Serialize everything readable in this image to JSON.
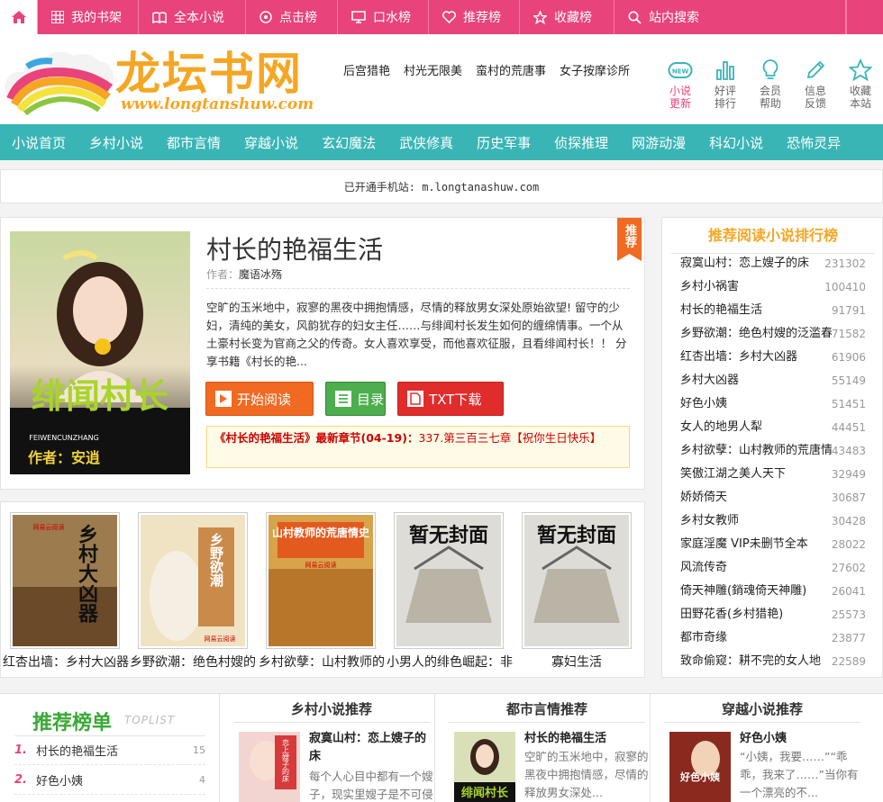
{
  "topnav": {
    "items": [
      {
        "label": "我的书架",
        "icon": "grid-icon"
      },
      {
        "label": "全本小说",
        "icon": "book-icon"
      },
      {
        "label": "点击榜",
        "icon": "target-icon"
      },
      {
        "label": "口水榜",
        "icon": "monitor-icon"
      },
      {
        "label": "推荐榜",
        "icon": "heart-icon"
      },
      {
        "label": "收藏榜",
        "icon": "star-icon"
      },
      {
        "label": "站内搜索",
        "icon": "search-icon"
      }
    ]
  },
  "header": {
    "logo_text": "龙坛书网",
    "logo_url": "www.longtanshuw.com",
    "hot_links": [
      "后宫猎艳",
      "村光无限美",
      "蛮村的荒唐事",
      "女子按摩诊所"
    ],
    "quick": [
      {
        "l1": "小说",
        "l2": "更新",
        "icon": "new-icon"
      },
      {
        "l1": "好评",
        "l2": "排行",
        "icon": "bar-chart-icon"
      },
      {
        "l1": "会员",
        "l2": "帮助",
        "icon": "lightbulb-icon"
      },
      {
        "l1": "信息",
        "l2": "反馈",
        "icon": "pencil-icon"
      },
      {
        "l1": "收藏",
        "l2": "本站",
        "icon": "star-outline-icon"
      }
    ]
  },
  "nav": [
    "小说首页",
    "乡村小说",
    "都市言情",
    "穿越小说",
    "玄幻魔法",
    "武侠修真",
    "历史军事",
    "侦探推理",
    "网游动漫",
    "科幻小说",
    "恐怖灵异"
  ],
  "mobile_notice": "已开通手机站: m.longtanashuw.com",
  "featured": {
    "badge": "推荐",
    "title": "村长的艳福生活",
    "author_label": "作者：",
    "author": "魔语冰殇",
    "description": "空旷的玉米地中，寂寥的黑夜中拥抱情感，尽情的释放男女深处原始欲望! 留守的少妇，清纯的美女，风韵犹存的妇女主任……与绯闻村长发生如何的缠绵情事。一个从土豪村长变为官商之父的传奇。女人喜欢享受，而他喜欢征服，且看绯闻村长！！  分享书籍《村长的艳...",
    "btn_read": "开始阅读",
    "btn_dir": "目录",
    "btn_txt": "TXT下载",
    "latest_name": "《村长的艳福生活》最新章节(04-19)：",
    "latest_chapter": "337.第三百三七章【祝你生日快乐】",
    "cover_title": "绯闻村长",
    "cover_pinyin": "FEIWENCUNZHANG",
    "cover_author": "作者：安逍"
  },
  "strip": {
    "books": [
      {
        "cover_text": "乡村大凶器",
        "publisher": "网易云阅读"
      },
      {
        "cover_text": "乡野欲潮",
        "publisher": "网易云阅读"
      },
      {
        "cover_text": "山村教师的荒唐情史",
        "publisher": "网易云阅读"
      },
      {
        "cover_text": "暂无封面"
      },
      {
        "cover_text": "暂无封面"
      }
    ],
    "captions": [
      "红杏出墙：乡村大凶器",
      "乡野欲潮：绝色村嫂的",
      "乡村欲孽：山村教师的",
      "小男人的绯色崛起：非",
      "寡妇生活"
    ]
  },
  "rank": {
    "title": "推荐阅读小说排行榜",
    "items": [
      {
        "name": "寂寞山村：恋上嫂子的床",
        "count": "231302"
      },
      {
        "name": "乡村小祸害",
        "count": "100410"
      },
      {
        "name": "村长的艳福生活",
        "count": "91791"
      },
      {
        "name": "乡野欲潮：绝色村嫂的泛滥春",
        "count": "71582"
      },
      {
        "name": "红杏出墙：乡村大凶器",
        "count": "61906"
      },
      {
        "name": "乡村大凶器",
        "count": "55149"
      },
      {
        "name": "好色小姨",
        "count": "51451"
      },
      {
        "name": "女人的地男人犁",
        "count": "44451"
      },
      {
        "name": "乡村欲孽：山村教师的荒唐情",
        "count": "43483"
      },
      {
        "name": "笑傲江湖之美人天下",
        "count": "32949"
      },
      {
        "name": "娇娇倚天",
        "count": "30687"
      },
      {
        "name": "乡村女教师",
        "count": "30428"
      },
      {
        "name": "家庭淫魔  VIP未删节全本",
        "count": "28022"
      },
      {
        "name": "风流传奇",
        "count": "27602"
      },
      {
        "name": "倚天神雕(銷魂倚天神雕)",
        "count": "26041"
      },
      {
        "name": "田野花香(乡村猎艳)",
        "count": "25573"
      },
      {
        "name": "都市奇缘",
        "count": "23877"
      },
      {
        "name": "致命偷窥：耕不完的女人地",
        "count": "22589"
      }
    ]
  },
  "toplist": {
    "title": "推荐榜单",
    "subtitle": "TOPLIST",
    "items": [
      {
        "num": "1.",
        "name": "村长的艳福生活",
        "count": "15"
      },
      {
        "num": "2.",
        "name": "好色小姨",
        "count": "4"
      }
    ]
  },
  "recommend": [
    {
      "heading": "乡村小说推荐",
      "title": "寂寞山村：恋上嫂子的床",
      "desc": "每个人心目中都有一个嫂子，现实里嫂子是不可侵",
      "cover_text": "恋上嫂子的床"
    },
    {
      "heading": "都市言情推荐",
      "title": "村长的艳福生活",
      "desc": "空旷的玉米地中，寂寥的黑夜中拥抱情感，尽情的释放男女深处...",
      "cover_text": "绯闻村长"
    },
    {
      "heading": "穿越小说推荐",
      "title": "好色小姨",
      "desc": "“小姨，我要……”“乖乖，我来了……”当你有一个漂亮的不...",
      "cover_text": "好色小姨"
    }
  ]
}
